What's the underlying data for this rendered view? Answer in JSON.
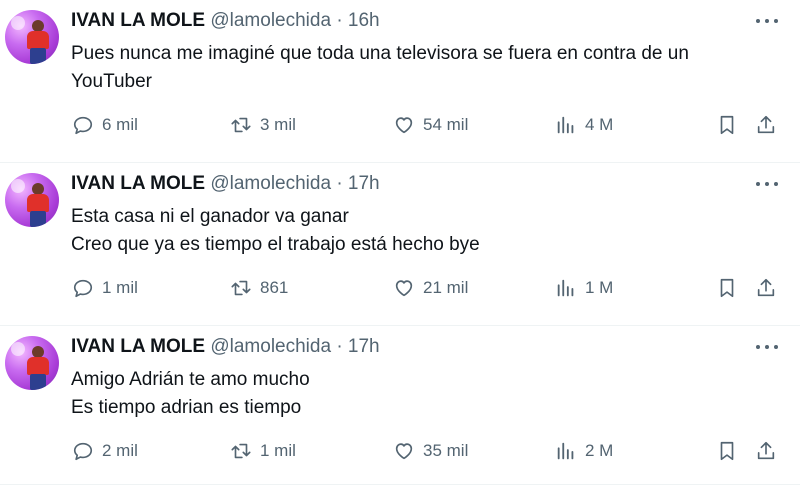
{
  "tweets": [
    {
      "name": "IVAN LA MOLE",
      "handle": "@lamolechida",
      "separator": "·",
      "time": "16h",
      "lines": [
        "Pues nunca me imaginé que toda una televisora se fuera en contra de un",
        "YouTuber"
      ],
      "replies": "6 mil",
      "retweets": "3 mil",
      "likes": "54 mil",
      "views": "4 M"
    },
    {
      "name": "IVAN LA MOLE",
      "handle": "@lamolechida",
      "separator": "·",
      "time": "17h",
      "lines": [
        "Esta casa ni el ganador va ganar",
        "Creo que ya es tiempo el trabajo está hecho bye"
      ],
      "replies": "1 mil",
      "retweets": "861",
      "likes": "21 mil",
      "views": "1 M"
    },
    {
      "name": "IVAN LA MOLE",
      "handle": "@lamolechida",
      "separator": "·",
      "time": "17h",
      "lines": [
        "Amigo Adrián te amo mucho",
        "Es tiempo adrian es tiempo"
      ],
      "replies": "2 mil",
      "retweets": "1 mil",
      "likes": "35 mil",
      "views": "2 M"
    }
  ],
  "icons": {
    "reply": "reply-icon",
    "retweet": "retweet-icon",
    "like": "heart-icon",
    "views": "views-chart-icon",
    "bookmark": "bookmark-icon",
    "share": "share-icon",
    "more": "more-dots-icon"
  },
  "colors": {
    "text": "#0f1419",
    "secondary": "#536471",
    "divider": "#eff3f4"
  }
}
